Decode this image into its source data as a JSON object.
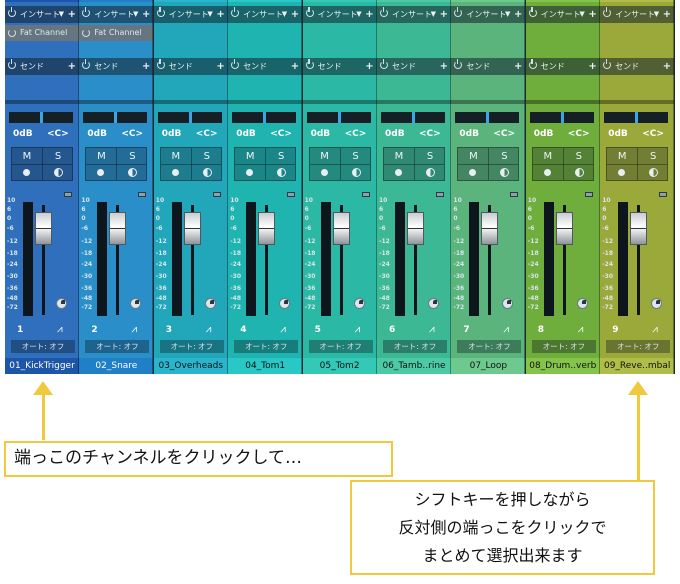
{
  "labels": {
    "insert": "インサート",
    "send": "センド",
    "volume": "0dB",
    "pan": "<C>",
    "mute": "M",
    "solo": "S",
    "automation": "オート: オフ",
    "fat_channel": "Fat Channel"
  },
  "meter_scale": [
    "10",
    "6",
    "0",
    "-6",
    "-12",
    "-18",
    "-24",
    "-30",
    "-36",
    "-48",
    "-72"
  ],
  "channels": [
    {
      "number": "1",
      "name": "01_KickTrigger",
      "color": "#2f6fbb",
      "name_color": "#1d55a8",
      "selected": true,
      "fat_channel": true
    },
    {
      "number": "2",
      "name": "02_Snare",
      "color": "#2a8ec9",
      "name_color": "#1f7fc7",
      "selected": true,
      "fat_channel": true
    },
    {
      "number": "3",
      "name": "03_Overheads",
      "color": "#21a6ba",
      "name_color": "#29b6cc",
      "selected": false,
      "fat_channel": false
    },
    {
      "number": "4",
      "name": "04_Tom1",
      "color": "#1fb4b0",
      "name_color": "#27c8c6",
      "selected": false,
      "fat_channel": false
    },
    {
      "number": "5",
      "name": "05_Tom2",
      "color": "#2bb8a4",
      "name_color": "#33c9b6",
      "selected": false,
      "fat_channel": false
    },
    {
      "number": "6",
      "name": "06_Tamb..rine",
      "color": "#3db894",
      "name_color": "#4ccaa6",
      "selected": false,
      "fat_channel": false
    },
    {
      "number": "7",
      "name": "07_Loop",
      "color": "#5ab47c",
      "name_color": "#6ec98e",
      "selected": false,
      "fat_channel": false
    },
    {
      "number": "8",
      "name": "08_Drum..verb",
      "color": "#6fad3c",
      "name_color": "#84c44a",
      "selected": false,
      "fat_channel": false
    },
    {
      "number": "9",
      "name": "09_Reve..mbal",
      "color": "#9ba83a",
      "name_color": "#aebe48",
      "selected": false,
      "fat_channel": false
    }
  ],
  "annotations": {
    "callout_1": "端っこのチャンネルをクリックして…",
    "callout_2": [
      "シフトキーを押しながら",
      "反対側の端っこをクリックで",
      "まとめて選択出来ます"
    ],
    "highlight_color": "#f0c93c"
  }
}
